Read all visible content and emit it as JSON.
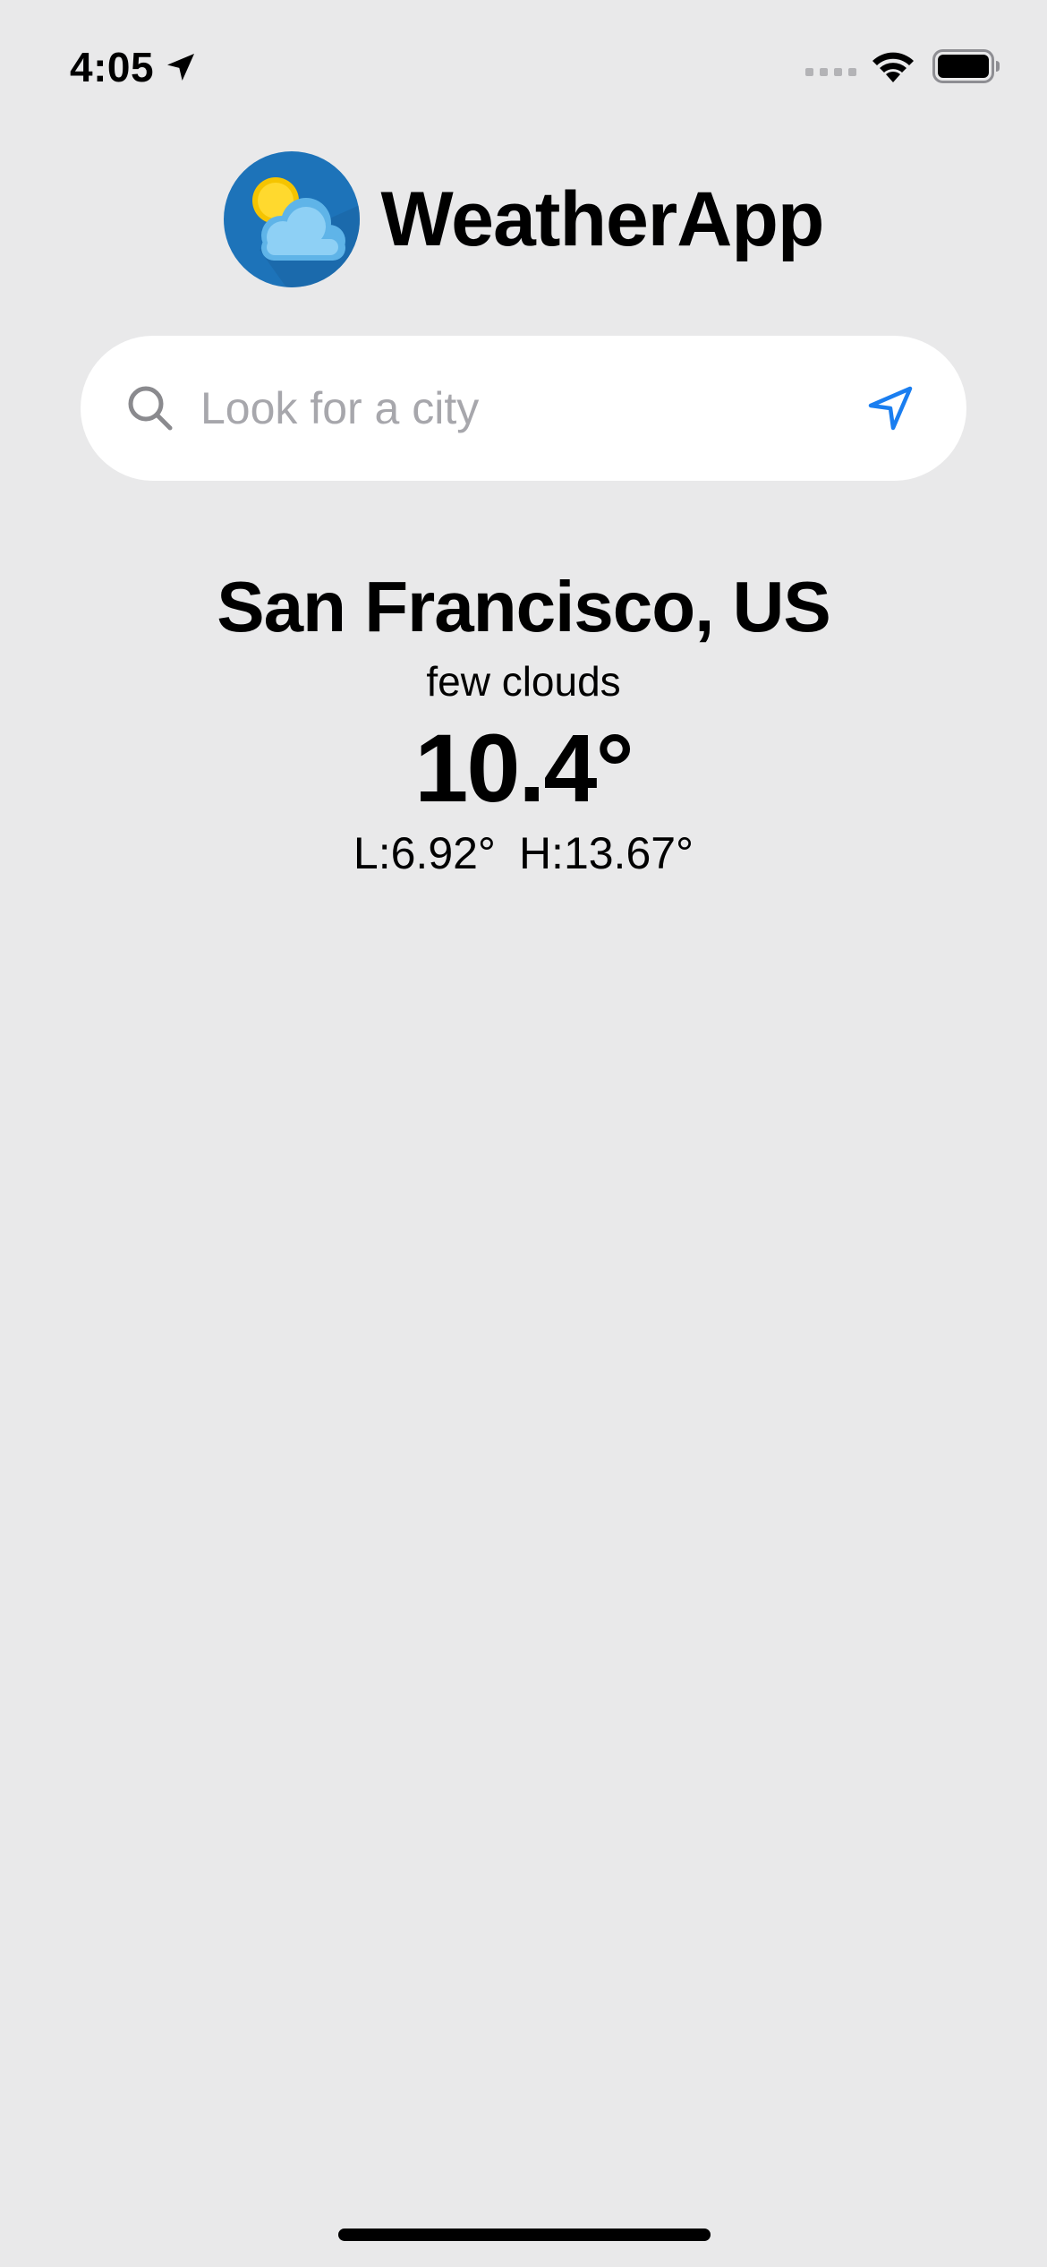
{
  "status_bar": {
    "time": "4:05",
    "icons": [
      "location-arrow-icon",
      "cellular-signal-icon",
      "wifi-icon",
      "battery-icon"
    ]
  },
  "app": {
    "title": "WeatherApp",
    "logo_icon": "sun-cloud-logo-icon"
  },
  "search": {
    "placeholder": "Look for a city",
    "value": "",
    "search_icon": "search-icon",
    "location_button_icon": "navigate-arrow-icon"
  },
  "weather": {
    "city": "San Francisco, US",
    "description": "few clouds",
    "temperature": "10.4°",
    "low": "L:6.92°",
    "high": "H:13.67°"
  },
  "colors": {
    "background": "#e9e9ea",
    "accent": "#1a7ef0",
    "logo_circle": "#1d73b9",
    "placeholder": "#a7a7ac"
  }
}
